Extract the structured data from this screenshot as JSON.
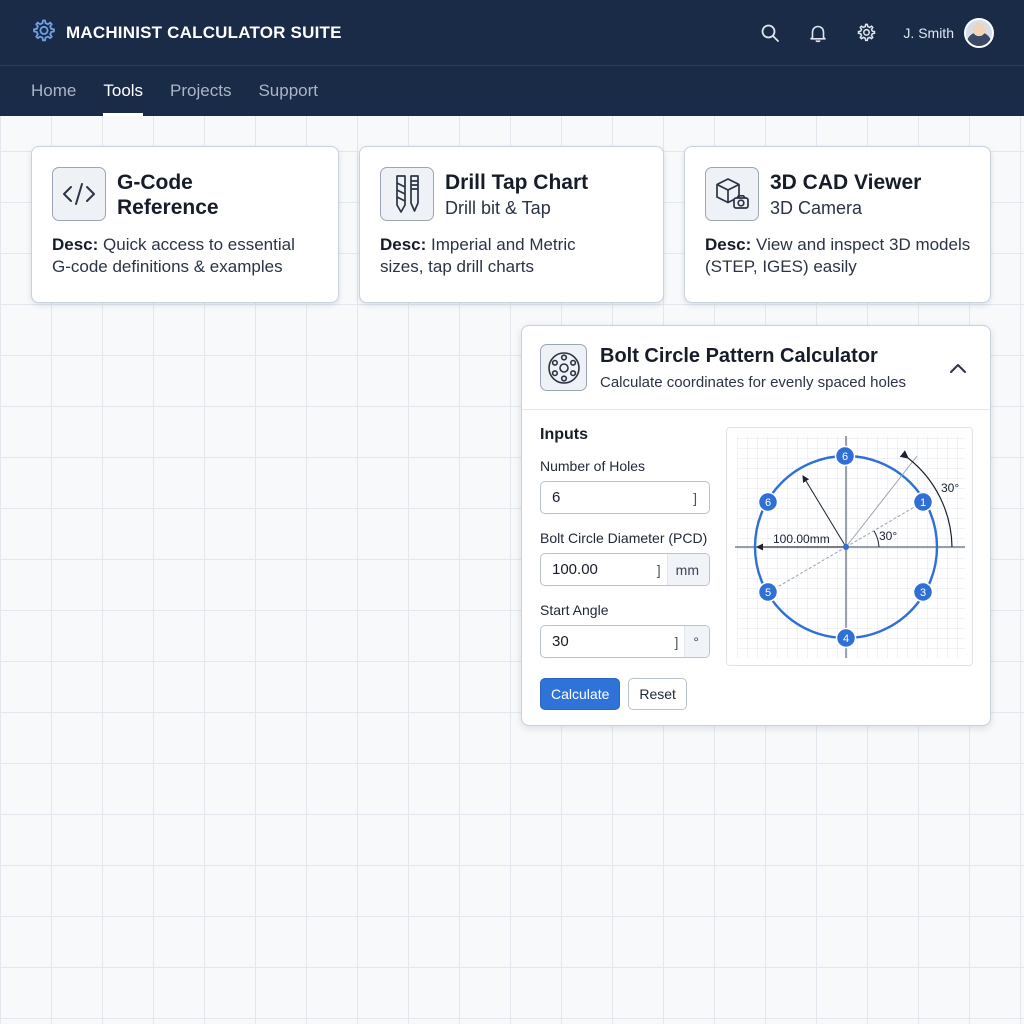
{
  "app": {
    "title": "MACHINIST CALCULATOR SUITE",
    "icon": "gear-icon"
  },
  "header": {
    "icons": [
      "search-icon",
      "bell-icon",
      "gear-icon"
    ],
    "user_name": "J. Smith"
  },
  "nav": {
    "items": [
      {
        "label": "Home",
        "active": false
      },
      {
        "label": "Tools",
        "active": true
      },
      {
        "label": "Projects",
        "active": false
      },
      {
        "label": "Support",
        "active": false
      }
    ]
  },
  "cards": [
    {
      "icon": "code-icon",
      "title_line1": "G-Code",
      "title_line2": "Reference",
      "desc_label": "Desc:",
      "desc_line1": "Quick access to essential",
      "desc_line2": "G-code definitions & examples"
    },
    {
      "icon": "drill-tap-icon",
      "title": "Drill Tap Chart",
      "subtitle": "Drill bit & Tap",
      "desc_label": "Desc:",
      "desc_line1": "Imperial and Metric",
      "desc_line2": "sizes, tap drill charts"
    },
    {
      "icon": "cube-camera-icon",
      "title": "3D CAD Viewer",
      "subtitle": "3D Camera",
      "desc_label": "Desc:",
      "desc_line1": "View and inspect 3D models",
      "desc_line2": "(STEP, IGES) easily"
    }
  ],
  "calculator": {
    "icon": "bolt-circle-icon",
    "title": "Bolt Circle Pattern Calculator",
    "subtitle": "Calculate coordinates for evenly spaced holes",
    "collapse_icon": "chevron-up-icon",
    "inputs_title": "Inputs",
    "fields": {
      "holes": {
        "label": "Number of Holes",
        "value": "6",
        "bracket": "]"
      },
      "pcd": {
        "label": "Bolt Circle Diameter (PCD)",
        "value": "100.00",
        "bracket": "]",
        "unit": "mm"
      },
      "angle": {
        "label": "Start Angle",
        "value": "30",
        "bracket": "]",
        "unit": "°"
      }
    },
    "buttons": {
      "calculate": "Calculate",
      "reset": "Reset"
    },
    "diagram": {
      "diameter_label": "100.00mm",
      "angle_label_outer": "30°",
      "angle_label_inner": "30°",
      "holes": [
        "6",
        "1",
        "6",
        "5",
        "3",
        "4"
      ],
      "accent_color": "#2f6fd6"
    }
  }
}
